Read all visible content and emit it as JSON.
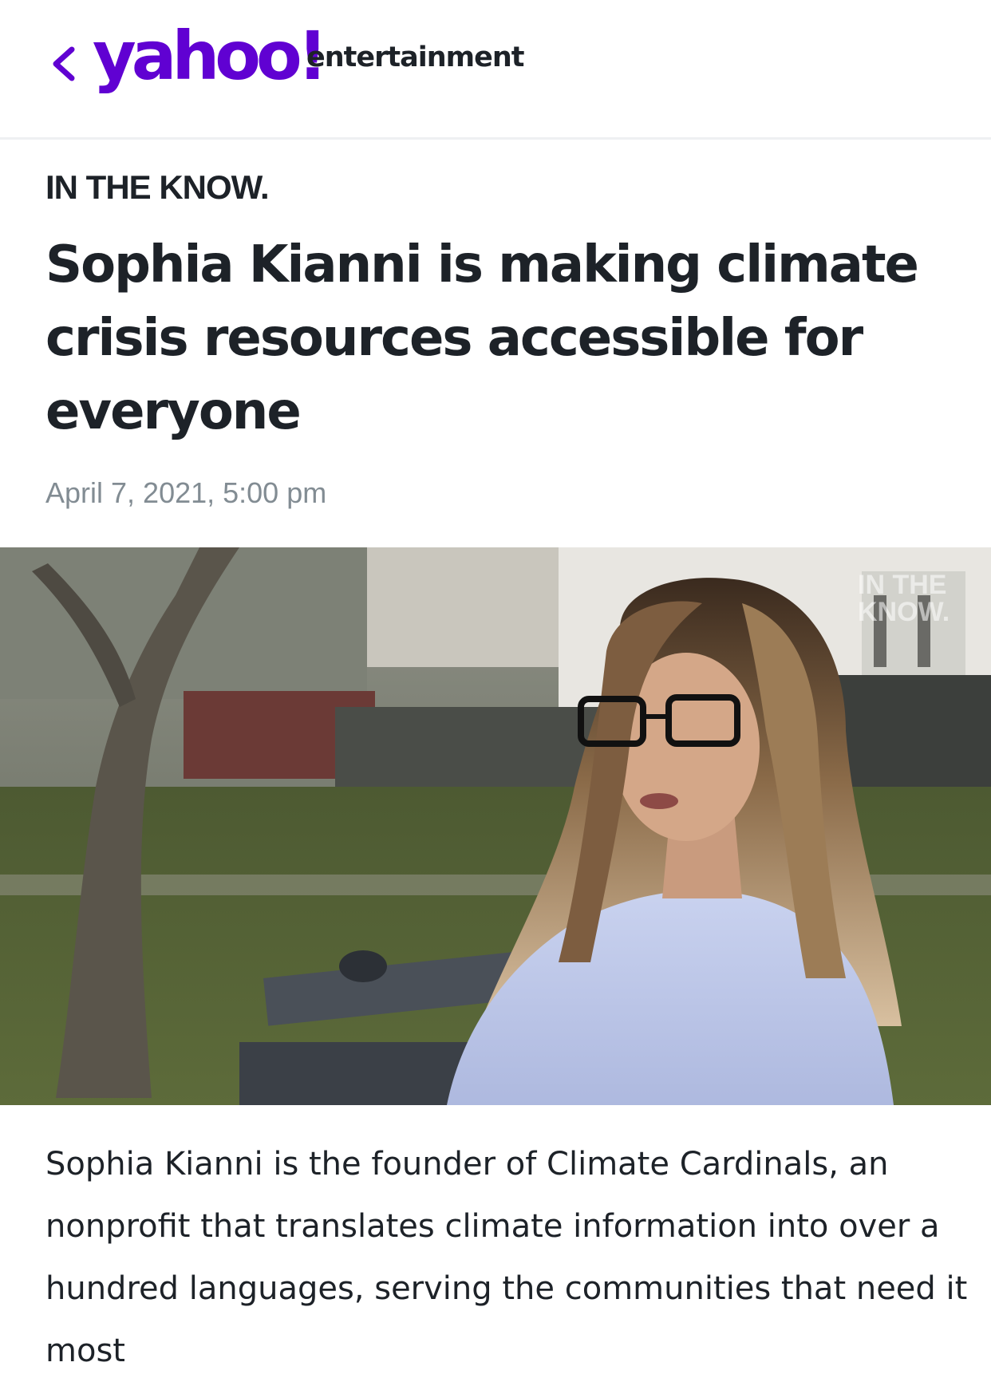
{
  "header": {
    "back_icon": "chevron-left-icon",
    "logo_text": "yahoo!",
    "section_text": "entertainment",
    "brand_color": "#6001d2"
  },
  "article": {
    "provider": "IN THE KNOW.",
    "title": "Sophia Kianni is making climate crisis resources accessible for everyone",
    "date": "April 7, 2021, 5:00 pm",
    "hero_watermark_line1": "IN THE",
    "hero_watermark_line2": "KNOW.",
    "caption": "Sophia Kianni is the founder of Climate Cardinals, an nonprofit that translates climate information into over a hundred languages, serving the communities that need it most"
  }
}
